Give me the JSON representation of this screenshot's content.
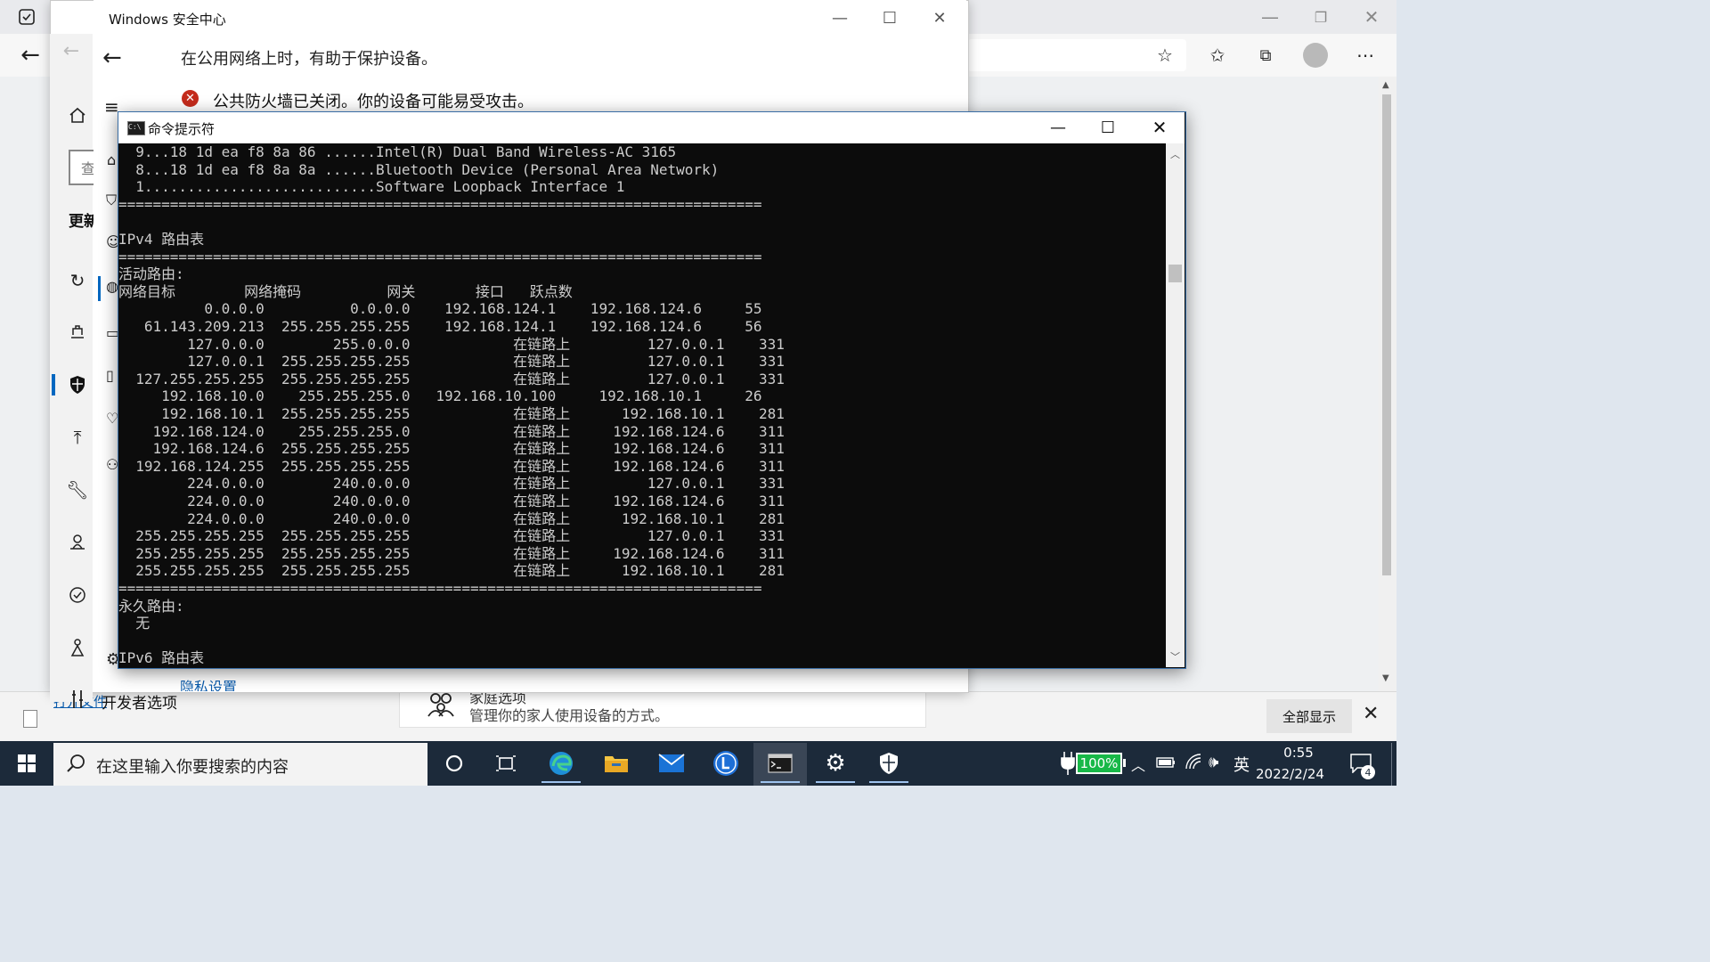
{
  "security_center": {
    "title": "Windows 安全中心",
    "subtitle": "在公用网络上时，有助于保护设备。",
    "warning": "公共防火墙已关闭。你的设备可能易受攻击。",
    "privacy_link": "隐私设置",
    "rail_partial_label": "更新",
    "search_partial": "查"
  },
  "settings_bottom": {
    "developer_label": "开发者选项",
    "family_title": "家庭选项",
    "family_desc": "管理你的家人使用设备的方式。",
    "open_link": "打开文件",
    "show_all_button": "全部显示"
  },
  "cmd": {
    "title": "命令提示符",
    "lines": [
      "  9...18 1d ea f8 8a 86 ......Intel(R) Dual Band Wireless-AC 3165",
      "  8...18 1d ea f8 8a 8a ......Bluetooth Device (Personal Area Network)",
      "  1...........................Software Loopback Interface 1",
      "===========================================================================",
      "",
      "IPv4 路由表",
      "===========================================================================",
      "活动路由:",
      "网络目标        网络掩码          网关       接口   跃点数",
      "          0.0.0.0          0.0.0.0    192.168.124.1    192.168.124.6     55",
      "   61.143.209.213  255.255.255.255    192.168.124.1    192.168.124.6     56",
      "        127.0.0.0        255.0.0.0            在链路上         127.0.0.1    331",
      "        127.0.0.1  255.255.255.255            在链路上         127.0.0.1    331",
      "  127.255.255.255  255.255.255.255            在链路上         127.0.0.1    331",
      "     192.168.10.0    255.255.255.0   192.168.10.100     192.168.10.1     26",
      "     192.168.10.1  255.255.255.255            在链路上      192.168.10.1    281",
      "    192.168.124.0    255.255.255.0            在链路上     192.168.124.6    311",
      "    192.168.124.6  255.255.255.255            在链路上     192.168.124.6    311",
      "  192.168.124.255  255.255.255.255            在链路上     192.168.124.6    311",
      "        224.0.0.0        240.0.0.0            在链路上         127.0.0.1    331",
      "        224.0.0.0        240.0.0.0            在链路上     192.168.124.6    311",
      "        224.0.0.0        240.0.0.0            在链路上      192.168.10.1    281",
      "  255.255.255.255  255.255.255.255            在链路上         127.0.0.1    331",
      "  255.255.255.255  255.255.255.255            在链路上     192.168.124.6    311",
      "  255.255.255.255  255.255.255.255            在链路上      192.168.10.1    281",
      "===========================================================================",
      "永久路由:",
      "  无",
      "",
      "IPv6 路由表"
    ]
  },
  "taskbar": {
    "search_placeholder": "在这里输入你要搜索的内容",
    "battery": "100%",
    "ime": "英",
    "time": "0:55",
    "date": "2022/2/24",
    "notifications": "4"
  }
}
